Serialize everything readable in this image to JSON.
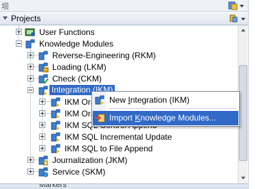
{
  "top_strip": {
    "partial_text": "坝"
  },
  "panel": {
    "title": "Projects"
  },
  "tree": {
    "items": [
      {
        "label": "User Functions",
        "icon": "user-functions-icon"
      },
      {
        "label": "Knowledge Modules",
        "icon": "folder-km-icon"
      },
      {
        "label": "Reverse-Engineering (RKM)",
        "icon": "rkm-icon"
      },
      {
        "label": "Loading (LKM)",
        "icon": "lkm-icon"
      },
      {
        "label": "Check (CKM)",
        "icon": "ckm-icon"
      },
      {
        "label": "Integration (IKM)",
        "icon": "ikm-icon"
      },
      {
        "label": "IKM Ora",
        "icon": "ikm-module-icon"
      },
      {
        "label": "IKM Ora",
        "icon": "ikm-module-icon"
      },
      {
        "label": "IKM SQL Control Append",
        "icon": "ikm-module-icon"
      },
      {
        "label": "IKM SQL Incremental Update",
        "icon": "ikm-module-icon"
      },
      {
        "label": "IKM SQL to File Append",
        "icon": "ikm-module-icon"
      },
      {
        "label": "Journalization (JKM)",
        "icon": "jkm-icon"
      },
      {
        "label": "Service (SKM)",
        "icon": "skm-icon"
      }
    ]
  },
  "context_menu": {
    "items": [
      {
        "label_pre": "New ",
        "label_u": "I",
        "label_post": "ntegration (IKM)",
        "icon": "new-integration-icon"
      },
      {
        "label_pre": "Import ",
        "label_u": "K",
        "label_post": "nowledge Modules...",
        "icon": "import-icon"
      }
    ]
  },
  "bottom": {
    "partial_label": "Markers"
  },
  "colors": {
    "selection": "#3169c6",
    "panel_header": "#dde5f0"
  }
}
